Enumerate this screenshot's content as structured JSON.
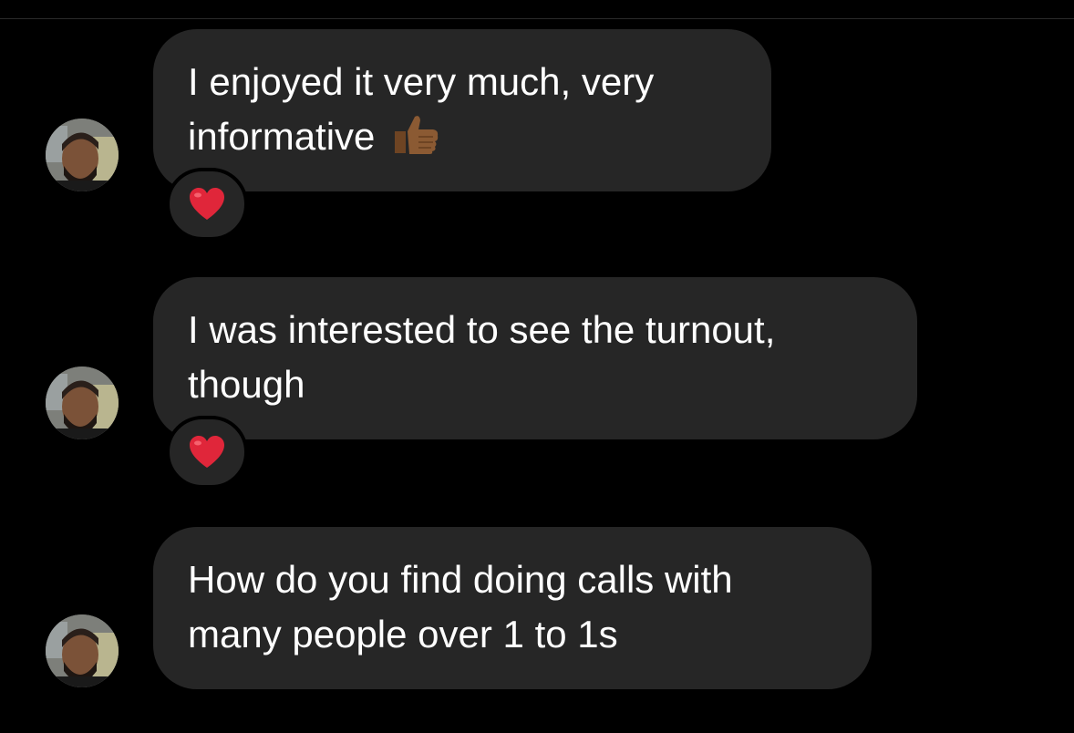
{
  "messages": [
    {
      "text_line1": "I enjoyed it very much, very",
      "text_line2": "informative",
      "emoji": "thumbs-up-icon",
      "reaction": "heart-icon"
    },
    {
      "text_line1": "I was interested to see the turnout,",
      "text_line2": "though",
      "reaction": "heart-icon"
    },
    {
      "text_line1": "How do you find doing calls with",
      "text_line2": "many people over 1 to 1s"
    }
  ],
  "colors": {
    "background": "#000000",
    "bubble": "#262626",
    "text": "#ffffff",
    "heart": "#e0263a",
    "thumb": "#8b5a33"
  }
}
